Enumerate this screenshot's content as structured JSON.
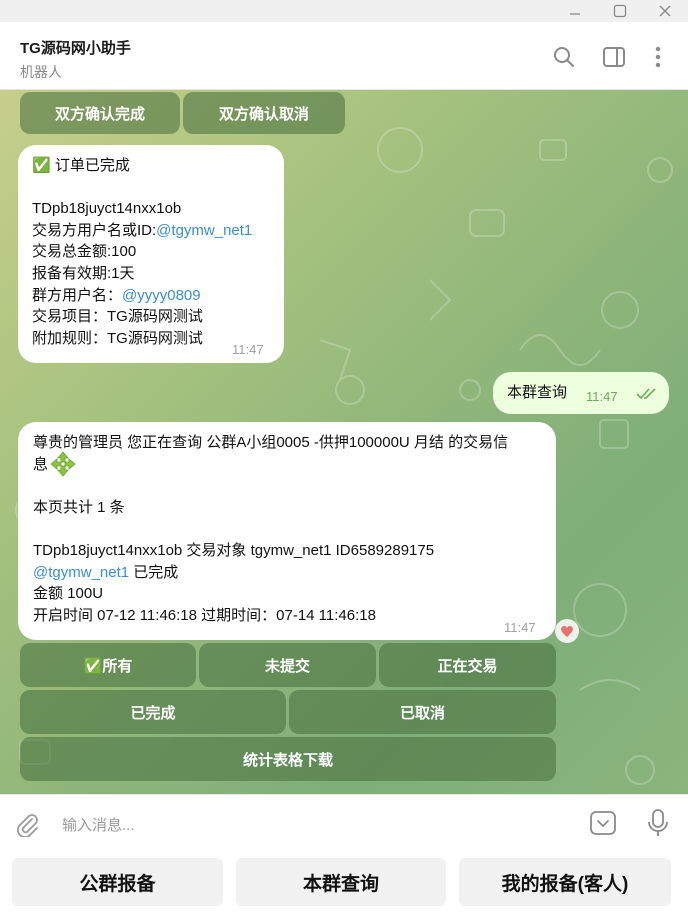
{
  "header": {
    "title": "TG源码网小助手",
    "subtitle": "机器人"
  },
  "top_buttons": [
    "双方确认完成",
    "双方确认取消"
  ],
  "msg1": {
    "lines": [
      "✅ 订单已完成",
      "",
      "TDpb18juyct14nxx1ob"
    ],
    "trader_label": "交易方用户名或ID:",
    "trader_link": "@tgymw_net1",
    "amount": "交易总金额:100",
    "validity": "报备有效期:1天",
    "group_label": "群方用户名：",
    "group_link": "@yyyy0809",
    "project": "交易项目：TG源码网测试",
    "rules": "附加规则：TG源码网测试",
    "time": "11:47"
  },
  "msg2": {
    "text": "本群查询",
    "time": "11:47"
  },
  "msg3": {
    "line1": "尊贵的管理员 您正在查询 公群A小组0005 -供押100000U 月结 的交易信",
    "line2": "息",
    "count": "本页共计 1 条",
    "record": "TDpb18juyct14nxx1ob 交易对象 tgymw_net1 ID6589289175",
    "record_link": "@tgymw_net1",
    "record_status": " 已完成",
    "amount": "金额 100U",
    "times": "开启时间 07-12 11:46:18 过期时间：07-14 11:46:18",
    "time": "11:47"
  },
  "inline_kb": {
    "row1": [
      "✅所有",
      "未提交",
      "正在交易"
    ],
    "row2": [
      "已完成",
      "已取消"
    ],
    "row3": [
      "统计表格下载"
    ]
  },
  "input": {
    "placeholder": "输入消息..."
  },
  "reply_kb": [
    "公群报备",
    "本群查询",
    "我的报备(客人)"
  ],
  "colors": {
    "link": "#3b8ed1",
    "check": "#5cb85c",
    "own_bubble": "#eeffde",
    "heart": "#e57373"
  }
}
